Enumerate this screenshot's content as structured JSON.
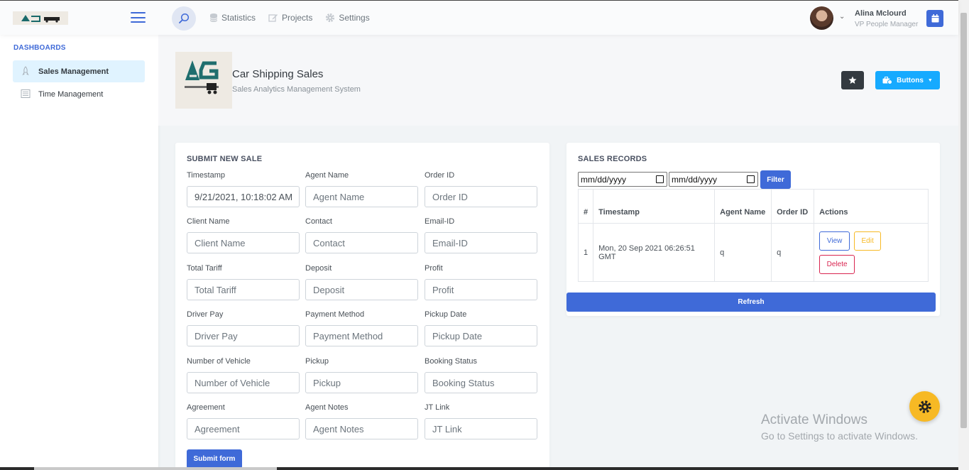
{
  "header": {
    "nav": [
      {
        "label": "Statistics",
        "icon": "database-icon"
      },
      {
        "label": "Projects",
        "icon": "edit-icon"
      },
      {
        "label": "Settings",
        "icon": "gear-icon"
      }
    ],
    "user_name": "Alina Mclourd",
    "user_role": "VP People Manager",
    "logo_text": "Car Shipping"
  },
  "sidebar": {
    "heading": "DASHBOARDS",
    "items": [
      {
        "label": "Sales Management",
        "active": true,
        "icon": "rocket-icon"
      },
      {
        "label": "Time Management",
        "active": false,
        "icon": "list-icon"
      }
    ]
  },
  "page": {
    "title": "Car Shipping Sales",
    "subtitle": "Sales Analytics Management System",
    "buttons_label": "Buttons",
    "logo_text": "Car Shipping"
  },
  "form": {
    "title": "SUBMIT NEW SALE",
    "fields": [
      {
        "label": "Timestamp",
        "placeholder": "",
        "value": "9/21/2021, 10:18:02 AM"
      },
      {
        "label": "Agent Name",
        "placeholder": "Agent Name",
        "value": ""
      },
      {
        "label": "Order ID",
        "placeholder": "Order ID",
        "value": ""
      },
      {
        "label": "Client Name",
        "placeholder": "Client Name",
        "value": ""
      },
      {
        "label": "Contact",
        "placeholder": "Contact",
        "value": ""
      },
      {
        "label": "Email-ID",
        "placeholder": "Email-ID",
        "value": ""
      },
      {
        "label": "Total Tariff",
        "placeholder": "Total Tariff",
        "value": ""
      },
      {
        "label": "Deposit",
        "placeholder": "Deposit",
        "value": ""
      },
      {
        "label": "Profit",
        "placeholder": "Profit",
        "value": ""
      },
      {
        "label": "Driver Pay",
        "placeholder": "Driver Pay",
        "value": ""
      },
      {
        "label": "Payment Method",
        "placeholder": "Payment Method",
        "value": ""
      },
      {
        "label": "Pickup Date",
        "placeholder": "Pickup Date",
        "value": ""
      },
      {
        "label": "Number of Vehicle",
        "placeholder": "Number of Vehicle",
        "value": ""
      },
      {
        "label": "Pickup",
        "placeholder": "Pickup",
        "value": ""
      },
      {
        "label": "Booking Status",
        "placeholder": "Booking Status",
        "value": ""
      },
      {
        "label": "Agreement",
        "placeholder": "Agreement",
        "value": ""
      },
      {
        "label": "Agent Notes",
        "placeholder": "Agent Notes",
        "value": ""
      },
      {
        "label": "JT Link",
        "placeholder": "JT Link",
        "value": ""
      }
    ],
    "submit_label": "Submit form"
  },
  "records": {
    "title": "SALES RECORDS",
    "date_from": "mm/dd/yyyy",
    "date_to": "mm/dd/yyyy",
    "filter_label": "Filter",
    "columns": [
      "#",
      "Timestamp",
      "Agent Name",
      "Order ID",
      "Actions"
    ],
    "rows": [
      {
        "num": "1",
        "timestamp": "Mon, 20 Sep 2021 06:26:51 GMT",
        "agent": "q",
        "order": "q"
      }
    ],
    "actions": {
      "view": "View",
      "edit": "Edit",
      "delete": "Delete"
    },
    "refresh_label": "Refresh"
  },
  "watermark": {
    "title": "Activate Windows",
    "subtitle": "Go to Settings to activate Windows."
  },
  "colors": {
    "primary": "#3f6ad8",
    "info": "#16aaff",
    "dark": "#343a40",
    "warning": "#f7b924",
    "danger": "#d92550",
    "sidebar_active": "#e0f3ff"
  }
}
